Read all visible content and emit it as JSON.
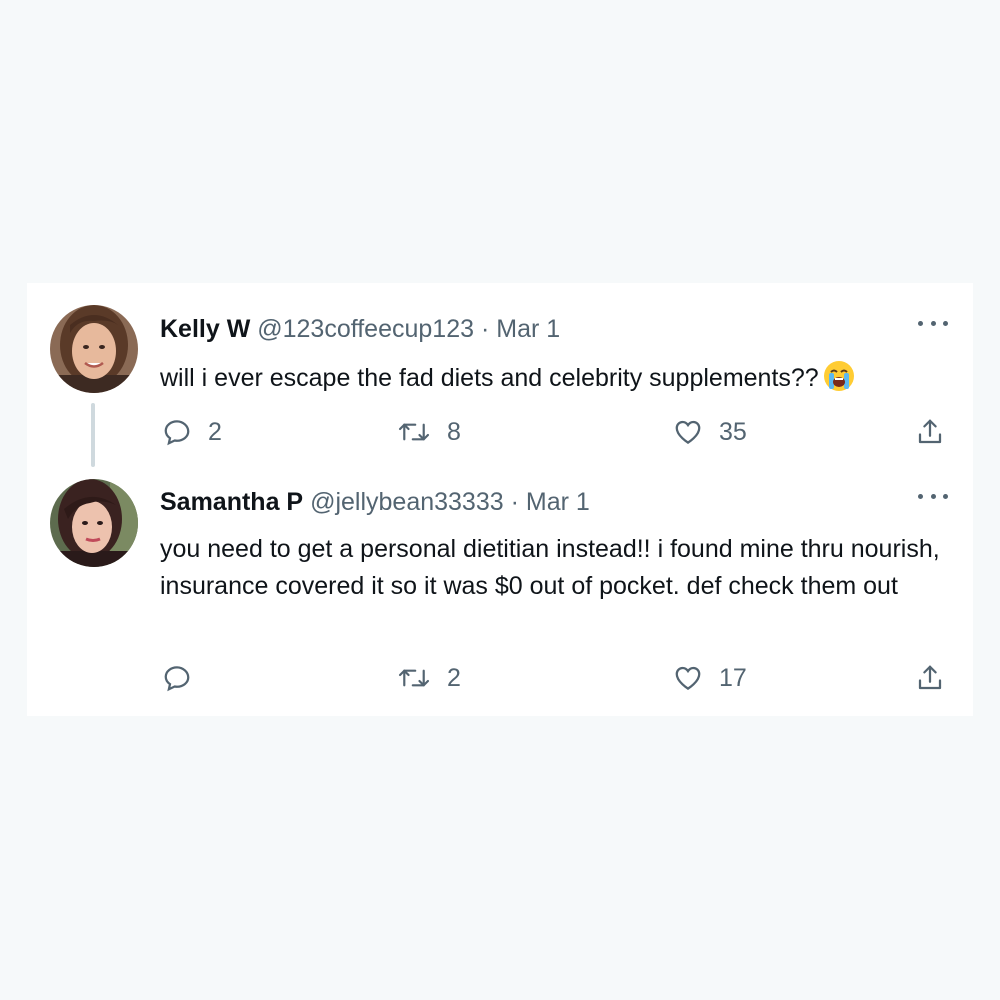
{
  "tweets": [
    {
      "display_name": "Kelly W",
      "handle": "@123coffeecup123",
      "separator": "·",
      "date": "Mar 1",
      "text": "will i ever escape the fad diets and celebrity supplements??",
      "emoji": "loudly-crying-face",
      "replies": "2",
      "retweets": "8",
      "likes": "35"
    },
    {
      "display_name": "Samantha P",
      "handle": "@jellybean33333",
      "separator": "·",
      "date": "Mar 1",
      "text": "you need to get a personal dietitian instead!! i found mine thru nourish, insurance covered it so it was $0 out of pocket. def check them out",
      "replies": "",
      "retweets": "2",
      "likes": "17"
    }
  ],
  "icons": {
    "reply": "reply-icon",
    "retweet": "retweet-icon",
    "like": "heart-icon",
    "share": "share-icon",
    "more": "more-icon"
  },
  "colors": {
    "background": "#f6f9fa",
    "card": "#ffffff",
    "text": "#0f1419",
    "secondary": "#536471",
    "thread_line": "#cfd9de"
  }
}
